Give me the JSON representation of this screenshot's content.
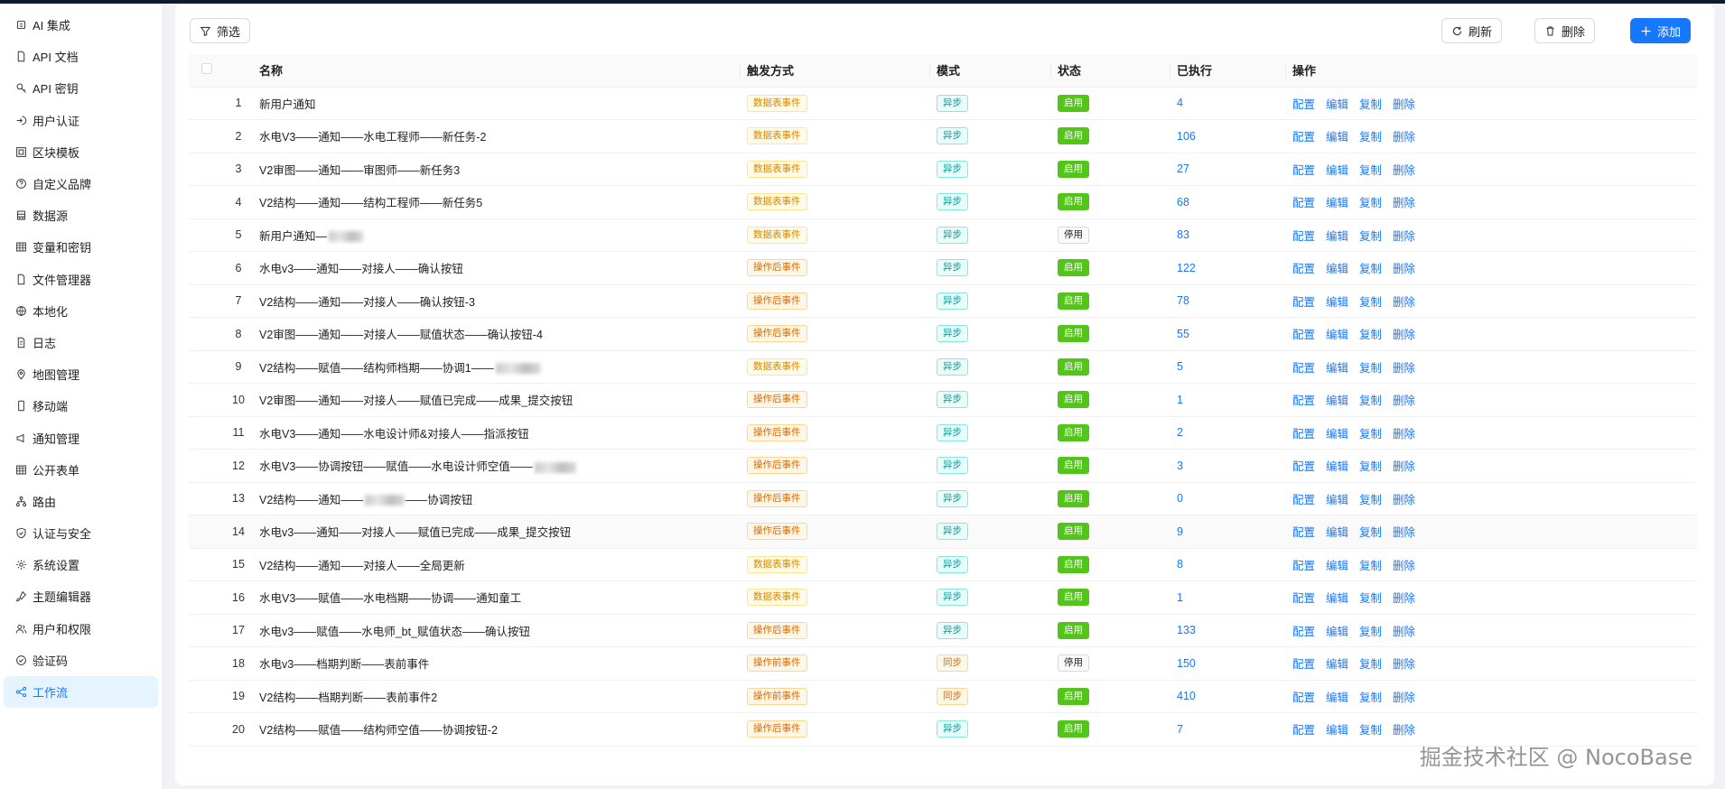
{
  "sidebar": {
    "items": [
      {
        "label": "AI 集成",
        "icon": "robot-icon"
      },
      {
        "label": "API 文档",
        "icon": "file-icon"
      },
      {
        "label": "API 密钥",
        "icon": "key-icon"
      },
      {
        "label": "用户认证",
        "icon": "login-icon"
      },
      {
        "label": "区块模板",
        "icon": "layout-icon"
      },
      {
        "label": "自定义品牌",
        "icon": "question-circle-icon"
      },
      {
        "label": "数据源",
        "icon": "database-icon"
      },
      {
        "label": "变量和密钥",
        "icon": "table-icon"
      },
      {
        "label": "文件管理器",
        "icon": "file-icon"
      },
      {
        "label": "本地化",
        "icon": "globe-icon"
      },
      {
        "label": "日志",
        "icon": "file-text-icon"
      },
      {
        "label": "地图管理",
        "icon": "location-icon"
      },
      {
        "label": "移动端",
        "icon": "mobile-icon"
      },
      {
        "label": "通知管理",
        "icon": "megaphone-icon"
      },
      {
        "label": "公开表单",
        "icon": "table-icon"
      },
      {
        "label": "路由",
        "icon": "cluster-icon"
      },
      {
        "label": "认证与安全",
        "icon": "shield-icon"
      },
      {
        "label": "系统设置",
        "icon": "gear-icon"
      },
      {
        "label": "主题编辑器",
        "icon": "brush-icon"
      },
      {
        "label": "用户和权限",
        "icon": "users-icon"
      },
      {
        "label": "验证码",
        "icon": "check-circle-icon"
      },
      {
        "label": "工作流",
        "icon": "workflow-icon"
      }
    ],
    "active_index": 21
  },
  "toolbar": {
    "filter_label": "筛选",
    "refresh_label": "刷新",
    "delete_label": "删除",
    "add_label": "添加"
  },
  "table": {
    "columns": [
      "名称",
      "触发方式",
      "模式",
      "状态",
      "已执行",
      "操作"
    ],
    "actions": [
      "配置",
      "编辑",
      "复制",
      "删除"
    ],
    "rows": [
      {
        "idx": "1",
        "name": "新用户通知",
        "trigger": "数据表事件",
        "mode": "异步",
        "status": "启用",
        "executed": "4"
      },
      {
        "idx": "2",
        "name": "水电V3——通知——水电工程师——新任务-2",
        "trigger": "数据表事件",
        "mode": "异步",
        "status": "启用",
        "executed": "106"
      },
      {
        "idx": "3",
        "name": "V2审图——通知——审图师——新任务3",
        "trigger": "数据表事件",
        "mode": "异步",
        "status": "启用",
        "executed": "27"
      },
      {
        "idx": "4",
        "name": "V2结构——通知——结构工程师——新任务5",
        "trigger": "数据表事件",
        "mode": "异步",
        "status": "启用",
        "executed": "68"
      },
      {
        "idx": "5",
        "name": "新用户通知—",
        "trigger": "数据表事件",
        "mode": "异步",
        "status": "停用",
        "executed": "83",
        "blur": 38
      },
      {
        "idx": "6",
        "name": "水电v3——通知——对接人——确认按钮",
        "trigger": "操作后事件",
        "mode": "异步",
        "status": "启用",
        "executed": "122"
      },
      {
        "idx": "7",
        "name": "V2结构——通知——对接人——确认按钮-3",
        "trigger": "操作后事件",
        "mode": "异步",
        "status": "启用",
        "executed": "78"
      },
      {
        "idx": "8",
        "name": "V2审图——通知——对接人——赋值状态——确认按钮-4",
        "trigger": "操作后事件",
        "mode": "异步",
        "status": "启用",
        "executed": "55"
      },
      {
        "idx": "9",
        "name": "V2结构——赋值——结构师档期——协调1——",
        "trigger": "数据表事件",
        "mode": "异步",
        "status": "启用",
        "executed": "5",
        "blur": 50
      },
      {
        "idx": "10",
        "name": "V2审图——通知——对接人——赋值已完成——成果_提交按钮",
        "trigger": "操作后事件",
        "mode": "异步",
        "status": "启用",
        "executed": "1"
      },
      {
        "idx": "11",
        "name": "水电V3——通知——水电设计师&对接人——指派按钮",
        "trigger": "操作后事件",
        "mode": "异步",
        "status": "启用",
        "executed": "2"
      },
      {
        "idx": "12",
        "name": "水电V3——协调按钮——赋值——水电设计师空值——",
        "trigger": "操作后事件",
        "mode": "异步",
        "status": "启用",
        "executed": "3",
        "blur": 46
      },
      {
        "idx": "13",
        "name": "V2结构——通知——",
        "suffix": "——协调按钮",
        "trigger": "操作后事件",
        "mode": "异步",
        "status": "启用",
        "executed": "0",
        "blur": 44
      },
      {
        "idx": "14",
        "name": "水电v3——通知——对接人——赋值已完成——成果_提交按钮",
        "trigger": "操作后事件",
        "mode": "异步",
        "status": "启用",
        "executed": "9"
      },
      {
        "idx": "15",
        "name": "V2结构——通知——对接人——全局更新",
        "trigger": "数据表事件",
        "mode": "异步",
        "status": "启用",
        "executed": "8"
      },
      {
        "idx": "16",
        "name": "水电V3——赋值——水电档期——协调——通知童工",
        "trigger": "数据表事件",
        "mode": "异步",
        "status": "启用",
        "executed": "1"
      },
      {
        "idx": "17",
        "name": "水电v3——赋值——水电师_bt_赋值状态——确认按钮",
        "trigger": "操作后事件",
        "mode": "异步",
        "status": "启用",
        "executed": "133"
      },
      {
        "idx": "18",
        "name": "水电v3——档期判断——表前事件",
        "trigger": "操作前事件",
        "mode": "同步",
        "status": "停用",
        "executed": "150"
      },
      {
        "idx": "19",
        "name": "V2结构——档期判断——表前事件2",
        "trigger": "操作前事件",
        "mode": "同步",
        "status": "启用",
        "executed": "410"
      },
      {
        "idx": "20",
        "name": "V2结构——赋值——结构师空值——协调按钮-2",
        "trigger": "操作后事件",
        "mode": "异步",
        "status": "启用",
        "executed": "7"
      }
    ],
    "highlighted_row": 14
  },
  "watermark": "掘金技术社区 @ NocoBase"
}
